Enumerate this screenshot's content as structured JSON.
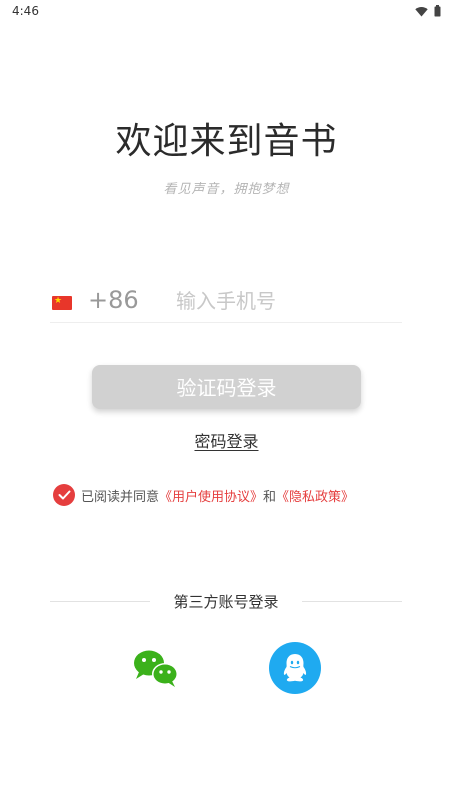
{
  "status_bar": {
    "time": "4:46"
  },
  "header": {
    "title": "欢迎来到音书",
    "subtitle": "看见声音，拥抱梦想"
  },
  "phone_form": {
    "country_code": "+86",
    "phone_placeholder": "输入手机号",
    "sms_login_label": "验证码登录",
    "password_login_label": "密码登录"
  },
  "agreement": {
    "checked": true,
    "prefix": "已阅读并同意",
    "user_agreement": "《用户使用协议》",
    "conjunction": "和",
    "privacy_policy": "《隐私政策》"
  },
  "third_party": {
    "label": "第三方账号登录",
    "providers": [
      "wechat-icon",
      "qq-icon"
    ]
  },
  "colors": {
    "accent": "#e53e3e",
    "button_disabled": "#d1d1d1",
    "wechat_green": "#3bb11b",
    "qq_blue": "#1faaf0"
  }
}
